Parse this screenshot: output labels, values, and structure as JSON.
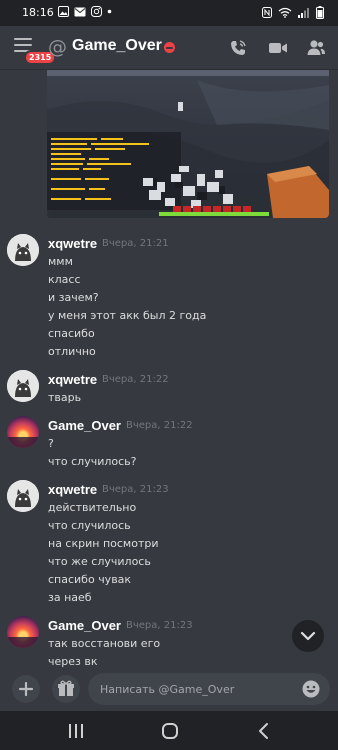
{
  "status_bar": {
    "time": "18:16",
    "left_icons": [
      "gallery-icon",
      "email-icon",
      "instagram-icon",
      "dot-icon"
    ],
    "right_icons": [
      "nfc-icon",
      "wifi-icon",
      "signal-icon",
      "battery-icon"
    ]
  },
  "header": {
    "menu_badge": "2315",
    "channel_name": "Game_Over",
    "status": "dnd"
  },
  "chat_image": {
    "description_icon": "minecraft-screenshot"
  },
  "messages": [
    {
      "user": "xqwetre",
      "timestamp": "Вчера, 21:21",
      "avatar": "cat-avatar",
      "lines": [
        "ммм",
        "класс",
        "и зачем?",
        "у меня этот акк был 2 года",
        "спасибо",
        "отлично"
      ]
    },
    {
      "user": "xqwetre",
      "timestamp": "Вчера, 21:22",
      "avatar": "cat-avatar",
      "lines": [
        "тварь"
      ]
    },
    {
      "user": "Game_Over",
      "timestamp": "Вчера, 21:22",
      "avatar": "sunset-avatar",
      "lines": [
        "?",
        "что случилось?"
      ]
    },
    {
      "user": "xqwetre",
      "timestamp": "Вчера, 21:23",
      "avatar": "cat-avatar",
      "lines": [
        "действительно",
        "что случилось",
        "на скрин посмотри",
        "что же случилось",
        "спасибо чувак",
        "за наеб"
      ]
    },
    {
      "user": "Game_Over",
      "timestamp": "Вчера, 21:23",
      "avatar": "sunset-avatar",
      "lines": [
        "так восстанови его",
        "через вк"
      ]
    }
  ],
  "composer": {
    "placeholder": "Написать @Game_Over"
  },
  "colors": {
    "background": "#36393f",
    "dark": "#202225",
    "text": "#dcddde",
    "muted": "#72767d",
    "accent_red": "#ed4245"
  }
}
